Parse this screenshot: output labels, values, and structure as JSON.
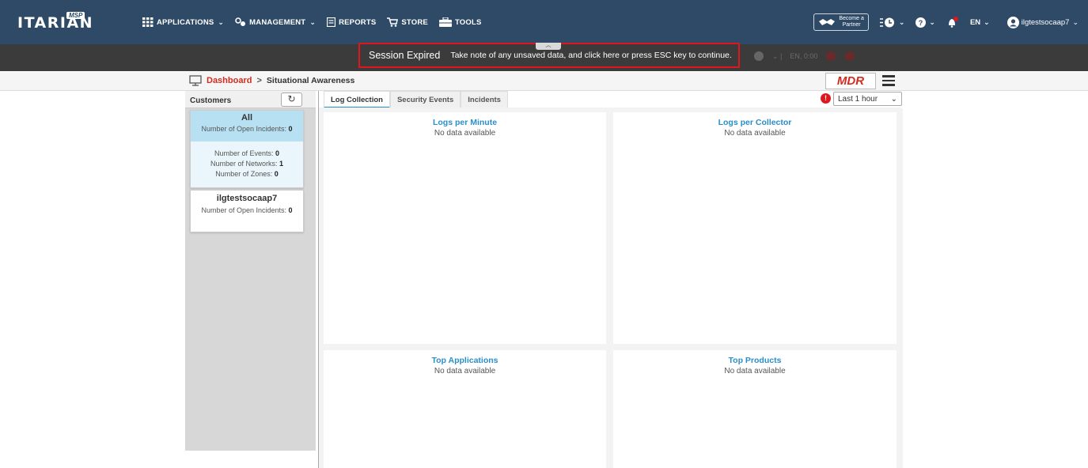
{
  "app": {
    "logo_text": "ITARIAN",
    "logo_badge": "MSP"
  },
  "nav": {
    "menu": [
      {
        "label": "APPLICATIONS",
        "has_dropdown": true,
        "icon": "grid-icon"
      },
      {
        "label": "MANAGEMENT",
        "has_dropdown": true,
        "icon": "gears-icon"
      },
      {
        "label": "REPORTS",
        "has_dropdown": false,
        "icon": "report-icon"
      },
      {
        "label": "STORE",
        "has_dropdown": false,
        "icon": "cart-icon"
      },
      {
        "label": "TOOLS",
        "has_dropdown": false,
        "icon": "toolbox-icon"
      }
    ],
    "partner_line1": "Become a",
    "partner_line2": "Partner",
    "language": "EN",
    "username": "ilgtestsocaap7"
  },
  "session": {
    "title": "Session Expired",
    "message": "Take note of any unsaved data, and click here or press ESC key to continue.",
    "faded_lang": "EN, 0:00"
  },
  "breadcrumb": {
    "home": "Dashboard",
    "separator": ">",
    "current": "Situational Awareness"
  },
  "mdr_label": "MDR",
  "customers": {
    "title": "Customers",
    "cards": [
      {
        "name": "All",
        "open_incidents_label": "Number of Open Incidents:",
        "open_incidents": "0",
        "events_label": "Number of Events:",
        "events": "0",
        "networks_label": "Number of Networks:",
        "networks": "1",
        "zones_label": "Number of Zones:",
        "zones": "0"
      },
      {
        "name": "ilgtestsocaap7",
        "open_incidents_label": "Number of Open Incidents:",
        "open_incidents": "0"
      }
    ]
  },
  "tabs": [
    "Log Collection",
    "Security Events",
    "Incidents"
  ],
  "active_tab": "Log Collection",
  "time_range": "Last 1 hour",
  "widgets": [
    {
      "title": "Logs per Minute",
      "status": "No data available"
    },
    {
      "title": "Logs per Collector",
      "status": "No data available"
    },
    {
      "title": "Top Applications",
      "status": "No data available"
    },
    {
      "title": "Top Products",
      "status": "No data available"
    }
  ],
  "colors": {
    "nav_bg": "#2e4a66",
    "session_bg": "#3b3b3b",
    "session_border": "#e0161e",
    "accent": "#2a8ec8",
    "brand_red": "#d42b1e"
  }
}
